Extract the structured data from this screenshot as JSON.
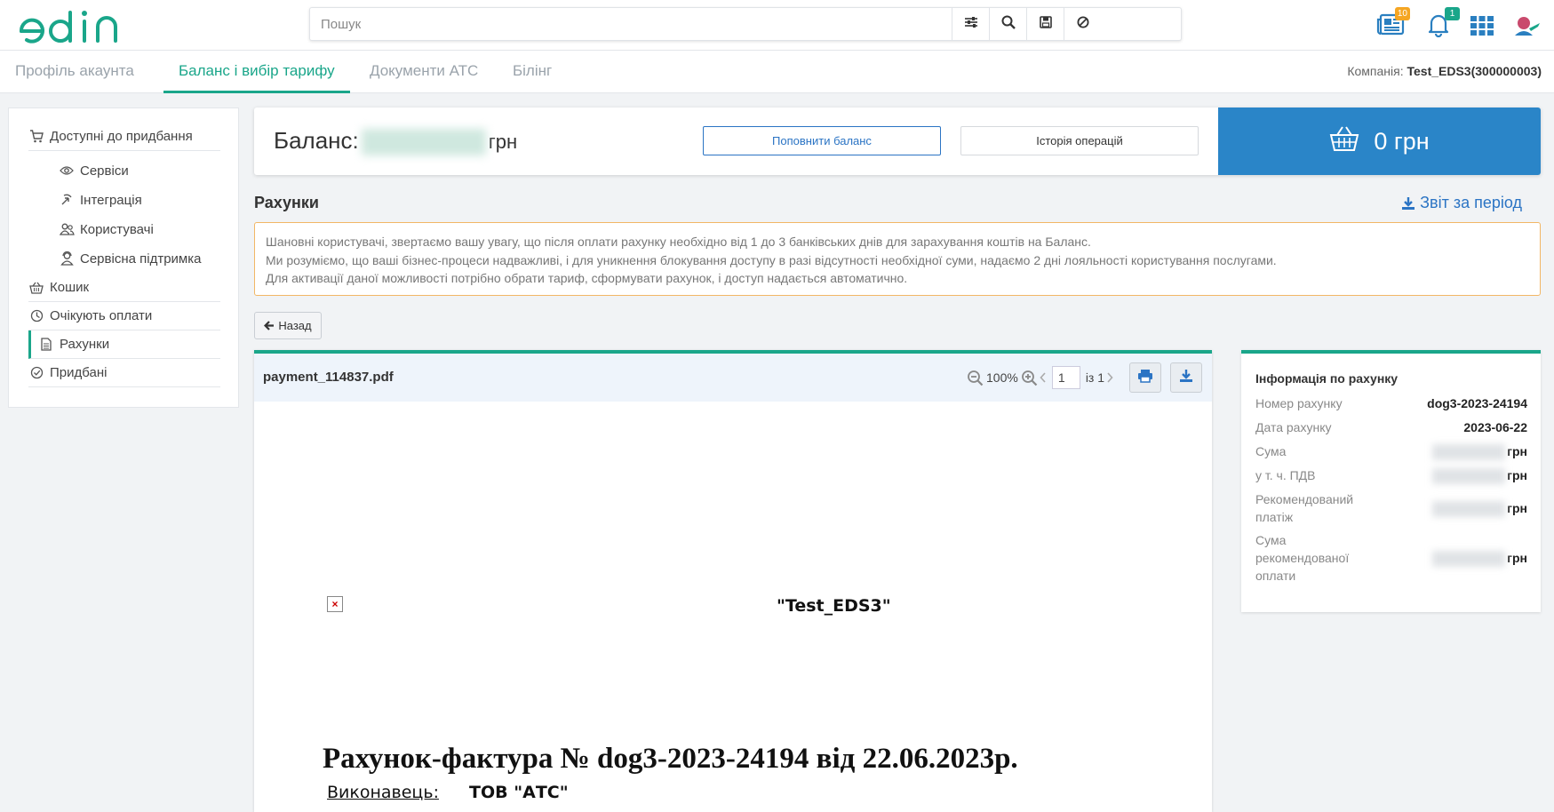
{
  "header": {
    "logo_text": "edin",
    "search_placeholder": "Пошук",
    "badges": {
      "news": "10",
      "notifications": "1"
    }
  },
  "nav": {
    "tabs": [
      {
        "label": "Профіль акаунта"
      },
      {
        "label": "Баланс і вибір тарифу"
      },
      {
        "label": "Документи АТС"
      },
      {
        "label": "Білінг"
      }
    ],
    "active_tab": "Баланс і вибір тарифу",
    "company_label": "Компанія:",
    "company_value": "Test_EDS3(300000003)"
  },
  "sidebar": {
    "items": [
      {
        "label": "Доступні до придбання",
        "icon": "cart-icon"
      },
      {
        "label": "Сервіси",
        "icon": "eye-icon"
      },
      {
        "label": "Інтеграція",
        "icon": "integration-icon"
      },
      {
        "label": "Користувачі",
        "icon": "users-icon"
      },
      {
        "label": "Сервісна підтримка",
        "icon": "support-icon"
      },
      {
        "label": "Кошик",
        "icon": "basket-icon"
      },
      {
        "label": "Очікують оплати",
        "icon": "clock-icon"
      },
      {
        "label": "Рахунки",
        "icon": "document-icon"
      },
      {
        "label": "Придбані",
        "icon": "check-circle-icon"
      }
    ],
    "active_item": "Рахунки"
  },
  "balance": {
    "label": "Баланс:",
    "unit": "грн",
    "topup_label": "Поповнити баланс",
    "history_label": "Історія операцій",
    "cart_amount": "0 грн"
  },
  "invoices": {
    "title": "Рахунки",
    "report_label": "Звіт за період",
    "notice_lines": [
      "Шановні користувачі, звертаємо вашу увагу, що після оплати рахунку необхідно від 1 до 3 банківських днів для зарахування коштів на Баланс.",
      "Ми розуміємо, що ваші бізнес-процеси надважливі, і для уникнення блокування доступу в разі відсутності необхідної суми, надаємо 2 дні лояльності користування послугами.",
      "Для активації даної можливості потрібно обрати тариф, сформувати рахунок, і доступ надається автоматично."
    ],
    "back_label": "Назад"
  },
  "viewer": {
    "filename": "payment_114837.pdf",
    "zoom": "100%",
    "page": "1",
    "of_pages": "із 1",
    "doc_company": "\"Test_EDS3\"",
    "doc_title": "Рахунок-фактура № dog3-2023-24194 від  22.06.2023р.",
    "doc_exec_label": "Виконавець:",
    "doc_exec_value": "ТОВ \"АТС\""
  },
  "info": {
    "title": "Інформація по рахунку",
    "rows": [
      {
        "label": "Номер рахунку",
        "value": "dog3-2023-24194"
      },
      {
        "label": "Дата рахунку",
        "value": "2023-06-22"
      },
      {
        "label": "Сума",
        "value": "грн"
      },
      {
        "label": "у т. ч. ПДВ",
        "value": "грн"
      },
      {
        "label": "Рекомендований платіж",
        "value": "грн"
      },
      {
        "label": "Сума рекомендованої оплати",
        "value": "грн"
      }
    ]
  },
  "colors": {
    "accent": "#1aa68a",
    "primary_blue": "#2a85c8",
    "link_blue": "#2b74c4",
    "notice_border": "#f2b766",
    "badge_orange": "#f5a623",
    "badge_green": "#1aa68a"
  }
}
